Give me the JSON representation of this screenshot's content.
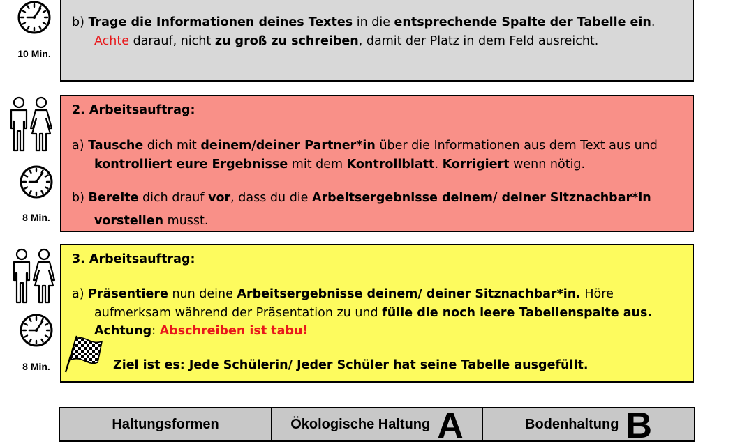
{
  "task1": {
    "time": "10 Min.",
    "line_b_1": [
      {
        "text": "b) ",
        "style": ""
      },
      {
        "text": "Trage die Informationen deines Textes",
        "style": "b"
      },
      {
        "text": " in die ",
        "style": ""
      },
      {
        "text": "entsprechende Spalte der Tabelle ein",
        "style": "b"
      },
      {
        "text": ".",
        "style": ""
      }
    ],
    "line_b_2": [
      {
        "text": "Achte",
        "style": "red"
      },
      {
        "text": " darauf, nicht ",
        "style": ""
      },
      {
        "text": "zu groß zu schreiben",
        "style": "b"
      },
      {
        "text": ", damit der Platz in dem Feld ausreicht.",
        "style": ""
      }
    ]
  },
  "task2": {
    "time": "8 Min.",
    "heading": [
      {
        "text": "2. ",
        "style": "b"
      },
      {
        "text": "Arbeitsauftrag:",
        "style": "b"
      }
    ],
    "a_1": [
      {
        "text": "a) ",
        "style": ""
      },
      {
        "text": "Tausche",
        "style": "b"
      },
      {
        "text": " dich mit ",
        "style": ""
      },
      {
        "text": "deinem/deiner Partner*in",
        "style": "b"
      },
      {
        "text": " über die Informationen aus dem Text aus und",
        "style": ""
      }
    ],
    "a_2": [
      {
        "text": "kontrolliert eure Ergebnisse",
        "style": "b"
      },
      {
        "text": " mit dem ",
        "style": ""
      },
      {
        "text": "Kontrollblatt",
        "style": "b"
      },
      {
        "text": ". ",
        "style": ""
      },
      {
        "text": "Korrigiert",
        "style": "b"
      },
      {
        "text": " wenn nötig.",
        "style": ""
      }
    ],
    "b_1": [
      {
        "text": "b) ",
        "style": ""
      },
      {
        "text": "Bereite",
        "style": "b"
      },
      {
        "text": " dich drauf ",
        "style": ""
      },
      {
        "text": "vor",
        "style": "b"
      },
      {
        "text": ", dass du die ",
        "style": ""
      },
      {
        "text": "Arbeitsergebnisse deinem/ deiner Sitznachbar*in",
        "style": "b"
      }
    ],
    "b_2": [
      {
        "text": "vorstellen",
        "style": "b"
      },
      {
        "text": " musst.",
        "style": ""
      }
    ]
  },
  "task3": {
    "time": "8 Min.",
    "heading": [
      {
        "text": "3. ",
        "style": "b"
      },
      {
        "text": "Arbeitsauftrag:",
        "style": "b"
      }
    ],
    "a_1": [
      {
        "text": "a) ",
        "style": ""
      },
      {
        "text": "Präsentiere",
        "style": "b"
      },
      {
        "text": " nun deine ",
        "style": ""
      },
      {
        "text": "Arbeitsergebnisse deinem/ deiner Sitznachbar*in.",
        "style": "b"
      },
      {
        "text": " Höre",
        "style": ""
      }
    ],
    "a_2": [
      {
        "text": "aufmerksam während der Präsentation zu und ",
        "style": ""
      },
      {
        "text": "fülle die noch leere Tabellenspalte aus.",
        "style": "b"
      }
    ],
    "a_3": [
      {
        "text": "Achtung",
        "style": "b"
      },
      {
        "text": ": ",
        "style": ""
      },
      {
        "text": "Abschreiben ist tabu!",
        "style": "red-b"
      }
    ],
    "goal": "Ziel ist es: Jede Schülerin/ Jeder Schüler hat seine Tabelle ausgefüllt."
  },
  "table_header": {
    "col1": "Haltungsformen",
    "col2": "Ökologische Haltung",
    "col2_letter": "A",
    "col3": "Bodenhaltung",
    "col3_letter": "B"
  },
  "colors": {
    "task1_bg": "#d8d8d8",
    "task2_bg": "#f99088",
    "task3_bg": "#fdfb5e",
    "header_bg": "#c8c8c8",
    "highlight_red": "#e8181b"
  },
  "icons": [
    "clock-icon",
    "partners-icon",
    "checkered-flag-icon"
  ]
}
